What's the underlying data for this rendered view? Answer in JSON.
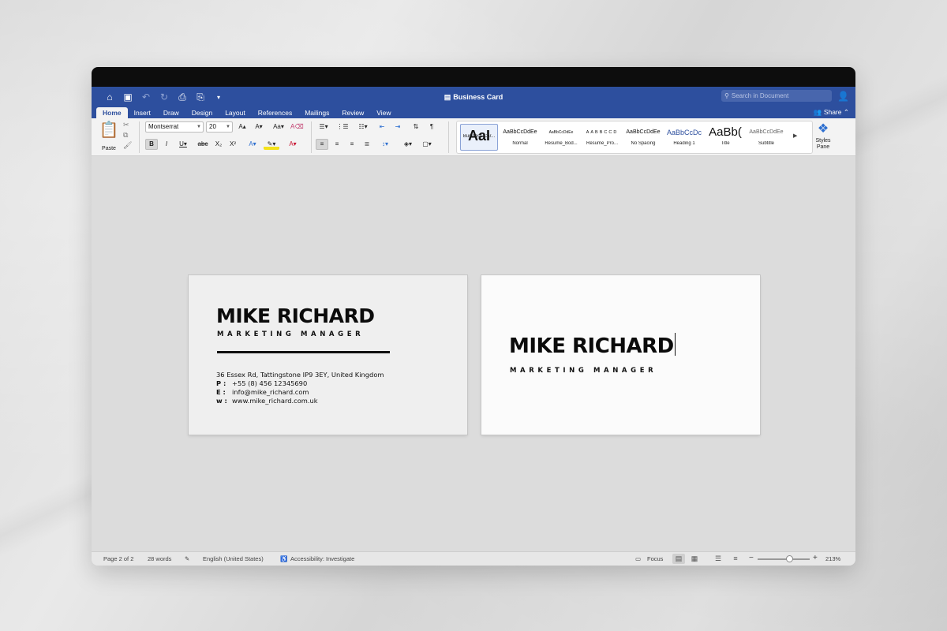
{
  "app": {
    "doc_title": "Business Card",
    "search_placeholder": "Search in Document",
    "share_label": "Share"
  },
  "quick_access": [
    "home-icon",
    "save-icon",
    "undo-icon",
    "redo-icon",
    "print-icon",
    "print-preview-icon",
    "customize-icon"
  ],
  "tabs": [
    {
      "label": "Home",
      "active": true
    },
    {
      "label": "Insert"
    },
    {
      "label": "Draw"
    },
    {
      "label": "Design"
    },
    {
      "label": "Layout"
    },
    {
      "label": "References"
    },
    {
      "label": "Mailings"
    },
    {
      "label": "Review"
    },
    {
      "label": "View"
    }
  ],
  "ribbon": {
    "paste_label": "Paste",
    "font_name": "Montserrat",
    "font_size": "20",
    "styles_pane_label": "Styles\nPane",
    "styles": [
      {
        "preview": "AaI",
        "name": "Business Car..."
      },
      {
        "preview": "AaBbCcDdEe",
        "name": "Normal"
      },
      {
        "preview": "AaBbCcDdEe",
        "name": "Resume_Bod..."
      },
      {
        "preview": "AABBCCD",
        "name": "Resume_Pro..."
      },
      {
        "preview": "AaBbCcDdEe",
        "name": "No Spacing"
      },
      {
        "preview": "AaBbCcDc",
        "name": "Heading 1"
      },
      {
        "preview": "AaBb(",
        "name": "Title"
      },
      {
        "preview": "AaBbCcDdEe",
        "name": "Subtitle"
      }
    ]
  },
  "card_back": {
    "name": "MIKE RICHARD",
    "title": "MARKETING MANAGER",
    "address": "36 Essex Rd, Tattingstone IP9 3EY, United Kingdom",
    "phone_label": "P :",
    "phone": "+55 (8) 456 12345690",
    "email_label": "E :",
    "email": "info@mike_richard.com",
    "web_label": "w :",
    "web": "www.mike_richard.com.uk"
  },
  "card_front": {
    "name": "MIKE RICHARD",
    "title": "MARKETING MANAGER"
  },
  "status": {
    "page": "Page 2 of 2",
    "words": "28 words",
    "language": "English (United States)",
    "accessibility": "Accessibility: Investigate",
    "focus": "Focus",
    "zoom": "213%"
  },
  "colors": {
    "accent": "#2d4f9e",
    "canvas": "#dcdcdc"
  }
}
